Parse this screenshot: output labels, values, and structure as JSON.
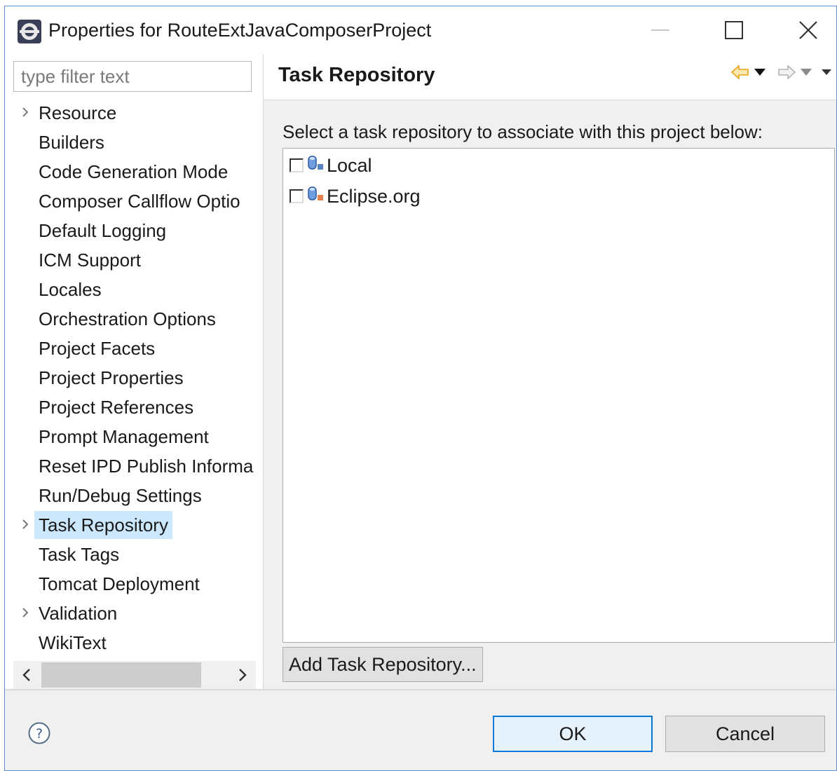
{
  "window": {
    "title": "Properties for RouteExtJavaComposerProject",
    "icon": "eclipse-icon"
  },
  "filter": {
    "placeholder": "type filter text"
  },
  "tree": {
    "items": [
      {
        "label": "Resource",
        "expandable": true,
        "selected": false
      },
      {
        "label": "Builders",
        "expandable": false,
        "selected": false
      },
      {
        "label": "Code Generation Mode",
        "expandable": false,
        "selected": false
      },
      {
        "label": "Composer Callflow Optio",
        "expandable": false,
        "selected": false
      },
      {
        "label": "Default Logging",
        "expandable": false,
        "selected": false
      },
      {
        "label": "ICM Support",
        "expandable": false,
        "selected": false
      },
      {
        "label": "Locales",
        "expandable": false,
        "selected": false
      },
      {
        "label": "Orchestration Options",
        "expandable": false,
        "selected": false
      },
      {
        "label": "Project Facets",
        "expandable": false,
        "selected": false
      },
      {
        "label": "Project Properties",
        "expandable": false,
        "selected": false
      },
      {
        "label": "Project References",
        "expandable": false,
        "selected": false
      },
      {
        "label": "Prompt Management",
        "expandable": false,
        "selected": false
      },
      {
        "label": "Reset IPD Publish Informa",
        "expandable": false,
        "selected": false
      },
      {
        "label": "Run/Debug Settings",
        "expandable": false,
        "selected": false
      },
      {
        "label": "Task Repository",
        "expandable": true,
        "selected": true
      },
      {
        "label": "Task Tags",
        "expandable": false,
        "selected": false
      },
      {
        "label": "Tomcat Deployment",
        "expandable": false,
        "selected": false
      },
      {
        "label": "Validation",
        "expandable": true,
        "selected": false
      },
      {
        "label": "WikiText",
        "expandable": false,
        "selected": false
      }
    ]
  },
  "page": {
    "title": "Task Repository",
    "description": "Select a task repository to associate with this project below:",
    "repositories": [
      {
        "label": "Local",
        "checked": false,
        "icon": "local-repository-icon"
      },
      {
        "label": "Eclipse.org",
        "checked": false,
        "icon": "bugzilla-repository-icon"
      }
    ],
    "add_button": "Add Task Repository..."
  },
  "footer": {
    "ok": "OK",
    "cancel": "Cancel"
  },
  "colors": {
    "selection": "#cce8ff",
    "accent": "#0078d7",
    "back_arrow": "#f5a623"
  }
}
